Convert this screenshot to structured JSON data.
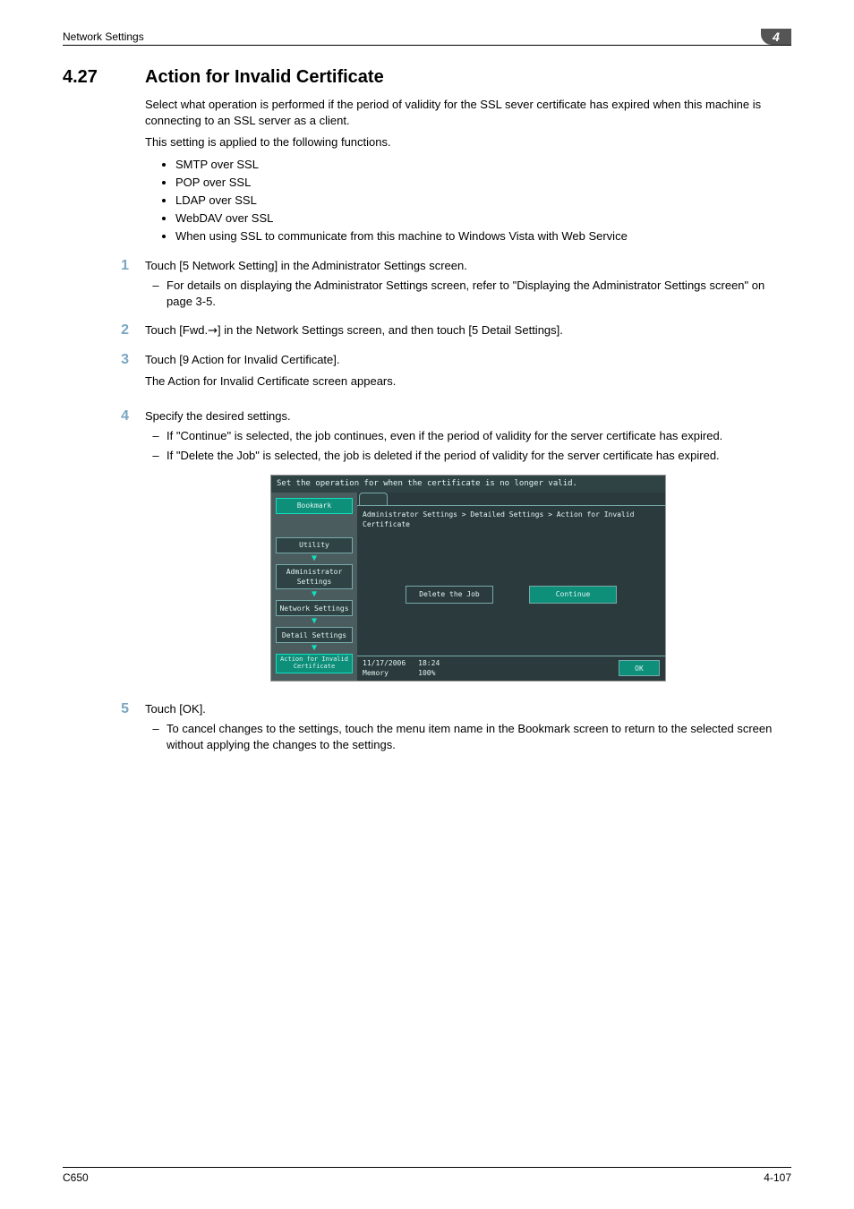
{
  "header": {
    "running_head": "Network Settings",
    "chapter_num": "4"
  },
  "heading": {
    "number": "4.27",
    "title": "Action for Invalid Certificate"
  },
  "intro": [
    "Select what operation is performed if the period of validity for the SSL sever certificate has expired when this machine is connecting to an SSL server as a client.",
    "This setting is applied to the following functions."
  ],
  "bullets": [
    "SMTP over SSL",
    "POP over SSL",
    "LDAP over SSL",
    "WebDAV over SSL",
    "When using SSL to communicate from this machine to Windows Vista with Web Service"
  ],
  "steps": [
    {
      "num": "1",
      "text": "Touch [5 Network Setting] in the Administrator Settings screen.",
      "subs": [
        "For details on displaying the Administrator Settings screen, refer to \"Displaying the Administrator Settings screen\" on page 3-5."
      ]
    },
    {
      "num": "2",
      "text_pre": "Touch [Fwd.",
      "arrow": "→",
      "text_post": "] in the Network Settings screen, and then touch [5 Detail Settings]."
    },
    {
      "num": "3",
      "text": "Touch [9 Action for Invalid Certificate].",
      "after": "The Action for Invalid Certificate screen appears."
    },
    {
      "num": "4",
      "text": "Specify the desired settings.",
      "subs": [
        "If \"Continue\" is selected, the job continues, even if the period of validity for the server certificate has expired.",
        "If \"Delete the Job\" is selected, the job is deleted if the period of validity for the server certificate has expired."
      ]
    },
    {
      "num": "5",
      "text": "Touch [OK].",
      "subs": [
        "To cancel changes to the settings, touch the menu item name in the Bookmark screen to return to the selected screen without applying the changes to the settings."
      ]
    }
  ],
  "screen": {
    "top_text": "Set the operation for when the certificate is no longer valid.",
    "bookmark": "Bookmark",
    "left_items": [
      "Utility",
      "Administrator Settings",
      "Network Settings",
      "Detail Settings",
      "Action for Invalid Certificate"
    ],
    "breadcrumb": "Administrator Settings > Detailed Settings > Action for Invalid Certificate",
    "choice_delete": "Delete the Job",
    "choice_continue": "Continue",
    "status_date": "11/17/2006",
    "status_time": "18:24",
    "status_mem_label": "Memory",
    "status_mem_val": "100%",
    "ok": "OK"
  },
  "footer": {
    "left": "C650",
    "right": "4-107"
  }
}
